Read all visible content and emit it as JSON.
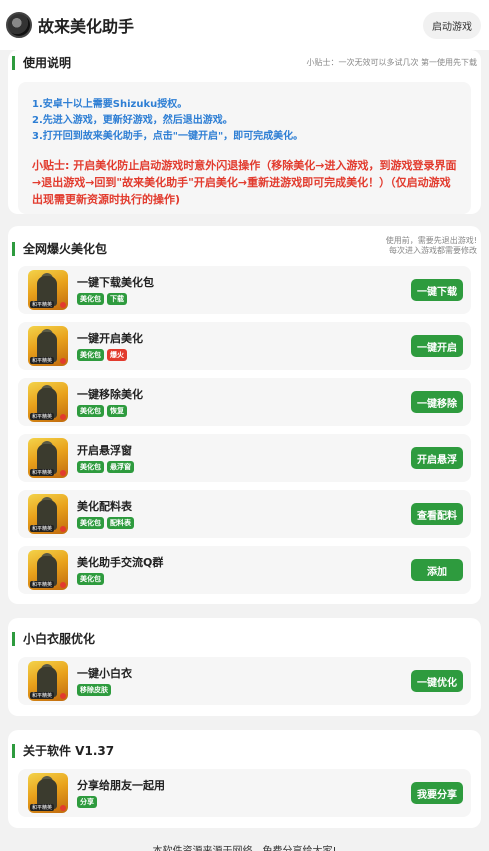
{
  "header": {
    "title": "故来美化助手",
    "launch_label": "启动游戏"
  },
  "usage": {
    "title": "使用说明",
    "tip": "小贴士：一次无效可以多试几次 第一使用先下载",
    "steps": [
      "1.安卓十以上需要Shizuku授权。",
      "2.先进入游戏，更新好游戏，然后退出游戏。",
      "3.打开回到故来美化助手，点击\"一键开启\"，即可完成美化。"
    ],
    "warning": "小贴士: 开启美化防止启动游戏时意外闪退操作（移除美化→进入游戏，到游戏登录界面→退出游戏→回到\"故来美化助手\"开启美化→重新进游戏即可完成美化！）（仅启动游戏出现需更新资源时执行的操作)"
  },
  "pack": {
    "title": "全网爆火美化包",
    "note1": "使用前，需要先退出游戏!",
    "note2": "每次进入游戏都需要修改",
    "items": [
      {
        "name": "一键下载美化包",
        "tags": [
          "美化包",
          "下载"
        ],
        "button": "一键下载"
      },
      {
        "name": "一键开启美化",
        "tags": [
          "美化包",
          "爆火"
        ],
        "button": "一键开启"
      },
      {
        "name": "一键移除美化",
        "tags": [
          "美化包",
          "恢复"
        ],
        "button": "一键移除"
      },
      {
        "name": "开启悬浮窗",
        "tags": [
          "美化包",
          "悬浮窗"
        ],
        "button": "开启悬浮"
      },
      {
        "name": "美化配料表",
        "tags": [
          "美化包",
          "配料表"
        ],
        "button": "查看配料"
      },
      {
        "name": "美化助手交流Q群",
        "tags": [
          "美化包"
        ],
        "button": "添加"
      }
    ]
  },
  "clothes": {
    "title": "小白衣服优化",
    "items": [
      {
        "name": "一键小白衣",
        "tags": [
          "移除皮肤"
        ],
        "button": "一键优化"
      }
    ]
  },
  "about": {
    "title": "关于软件 V1.37",
    "items": [
      {
        "name": "分享给朋友一起用",
        "tags": [
          "分享"
        ],
        "button": "我要分享"
      }
    ]
  },
  "thumb_label": "和平精英",
  "footer": "本软件资源来源于网络，免费分享给大家!",
  "colors": {
    "accent": "#2e9b3e",
    "blue": "#2d7ed4",
    "red": "#e23b2e"
  }
}
